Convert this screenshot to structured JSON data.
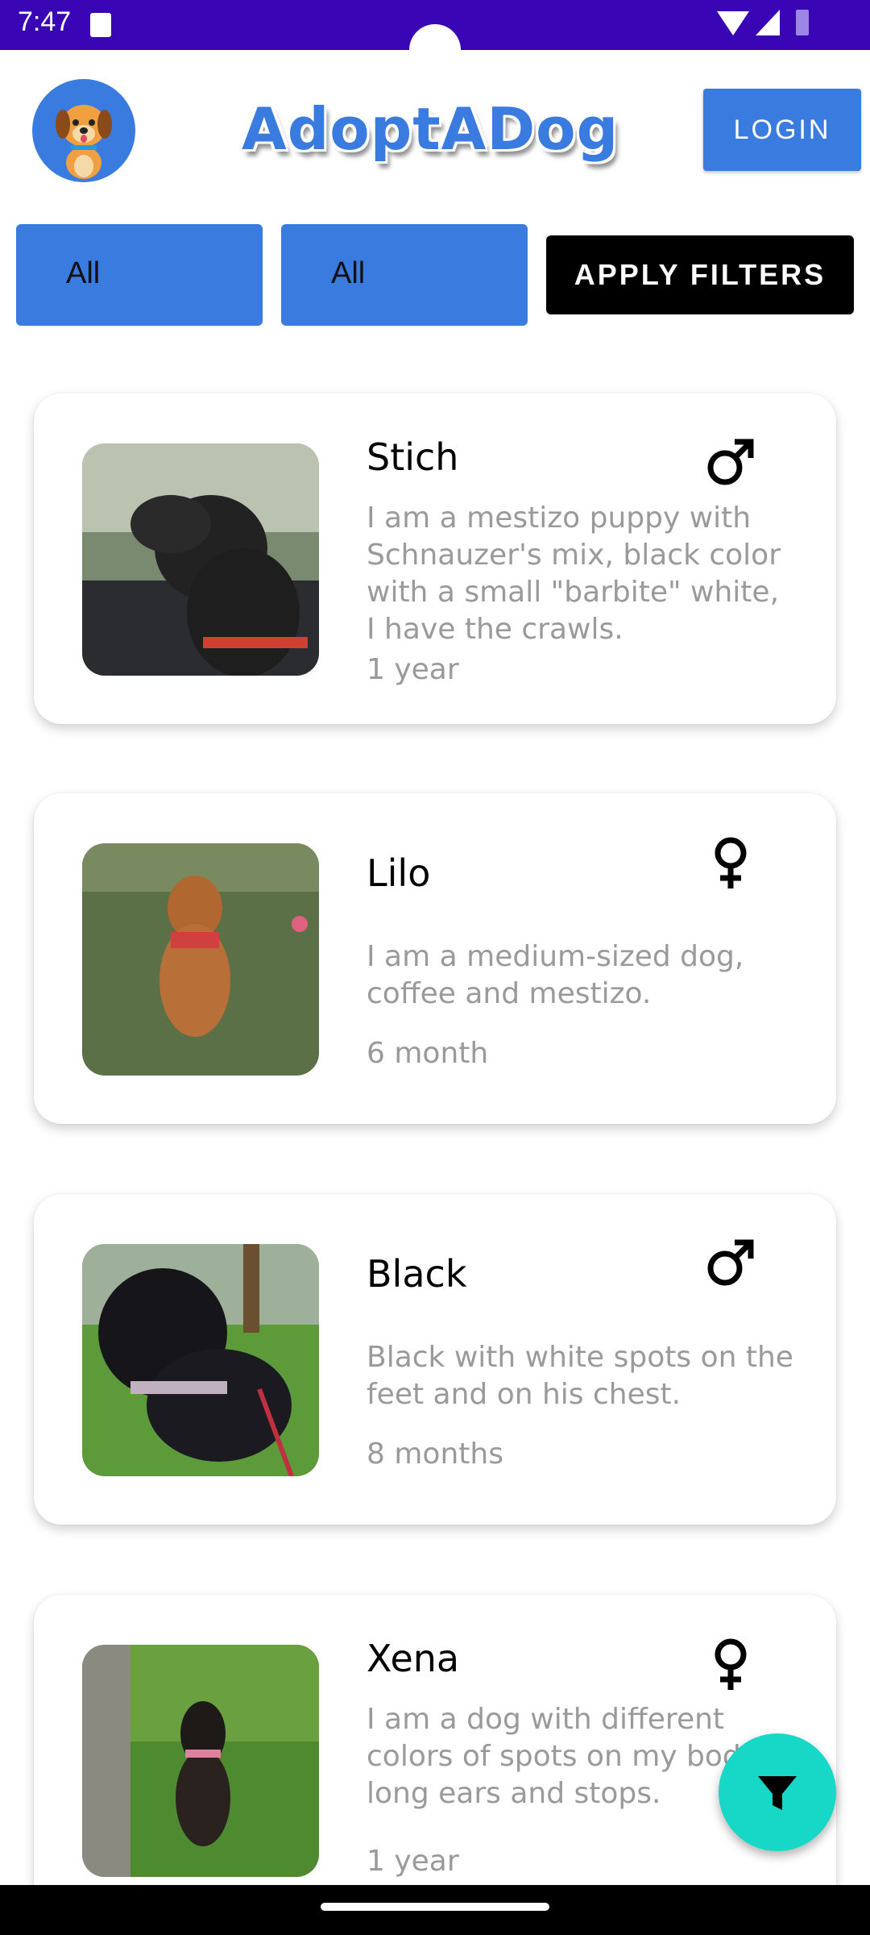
{
  "status_bar": {
    "time": "7:47"
  },
  "header": {
    "app_title": "AdoptADog",
    "login_label": "LOGIN"
  },
  "filters": {
    "filter1": "All",
    "filter2": "All",
    "apply_label": "APPLY FILTERS"
  },
  "dogs": [
    {
      "name": "Stich",
      "gender": "male",
      "description": "I am a mestizo puppy with Schnauzer's mix, black color with a small \"barbite\" white, I have the crawls.",
      "age": "1 year"
    },
    {
      "name": "Lilo",
      "gender": "female",
      "description": "I am a medium-sized dog, coffee and mestizo.",
      "age": "6 month"
    },
    {
      "name": "Black",
      "gender": "male",
      "description": "Black with white spots on the feet and on his chest.",
      "age": "8 months"
    },
    {
      "name": "Xena",
      "gender": "female",
      "description": "I am a dog with different colors of spots on my body, long ears and stops.",
      "age": "1 year"
    }
  ],
  "colors": {
    "accent": "#3a7be0",
    "status_bar": "#3a06b5",
    "fab": "#17d8c6"
  },
  "icons": {
    "fab": "filter-icon",
    "male": "male-symbol-icon",
    "female": "female-symbol-icon"
  }
}
